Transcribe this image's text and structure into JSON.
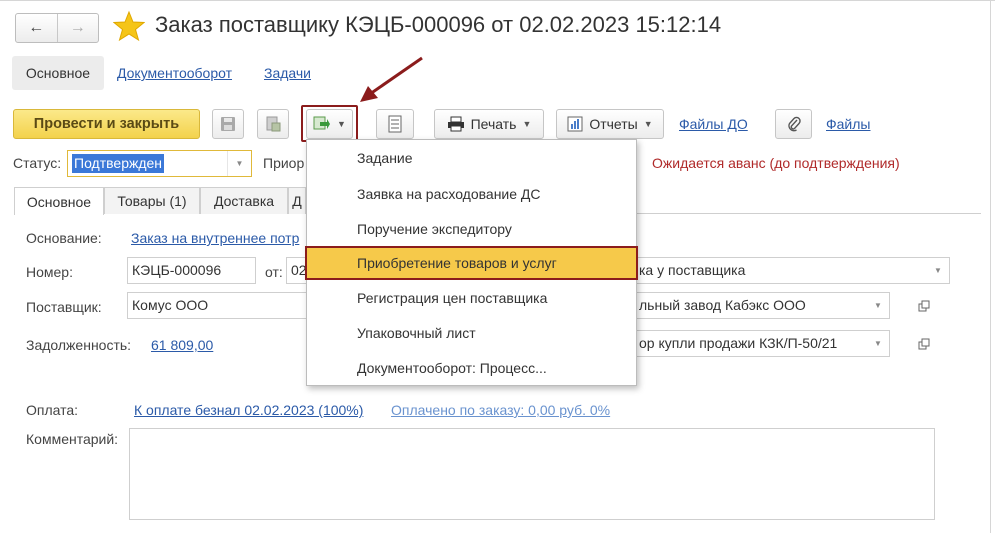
{
  "window": {
    "title": "Заказ поставщику КЭЦБ-000096 от 02.02.2023 15:12:14",
    "nav_back": "←",
    "nav_forward": "→"
  },
  "top_tabs": {
    "main": "Основное",
    "docflow": "Документооборот",
    "tasks": "Задачи"
  },
  "toolbar": {
    "post_close": "Провести и закрыть",
    "print": "Печать",
    "reports": "Отчеты",
    "files_do": "Файлы ДО",
    "files": "Файлы"
  },
  "status": {
    "label": "Статус:",
    "value": "Подтвержден",
    "priority_label": "Приор",
    "warning": "Ожидается аванс (до подтверждения)"
  },
  "inner_tabs": [
    {
      "label": "Основное"
    },
    {
      "label": "Товары (1)"
    },
    {
      "label": "Доставка"
    },
    {
      "label": "Д"
    }
  ],
  "form": {
    "basis_label": "Основание:",
    "basis_value": "Заказ на внутреннее потр",
    "number_label": "Номер:",
    "number_value": "КЭЦБ-000096",
    "from_label": "от:",
    "date_value": "02",
    "supplier_label": "Поставщик:",
    "supplier_value": "Комус ООО",
    "debt_label": "Задолженность:",
    "debt_value": "61 809,00",
    "right_field1": "ка у поставщика",
    "right_field2": "льный завод Кабэкс ООО",
    "right_field3": "ор купли продажи КЗК/П-50/21",
    "payment_label": "Оплата:",
    "payment_value": "К оплате безнал 02.02.2023 (100%)",
    "paid_value": "Оплачено по заказу: 0,00 руб. 0%",
    "comment_label": "Комментарий:"
  },
  "menu": {
    "items": [
      {
        "label": "Задание"
      },
      {
        "label": "Заявка на расходование ДС"
      },
      {
        "label": "Поручение экспедитору"
      },
      {
        "label": "Приобретение товаров и услуг"
      },
      {
        "label": "Регистрация цен поставщика"
      },
      {
        "label": "Упаковочный лист"
      },
      {
        "label": "Документооборот: Процесс..."
      }
    ],
    "selected_index": 3
  },
  "colors": {
    "accent_yellow": "#f3d24c",
    "link_blue": "#2b5aa8",
    "highlight_red": "#8b1c1c",
    "warning_red": "#b02a2a",
    "menu_selected": "#f6c94a"
  }
}
